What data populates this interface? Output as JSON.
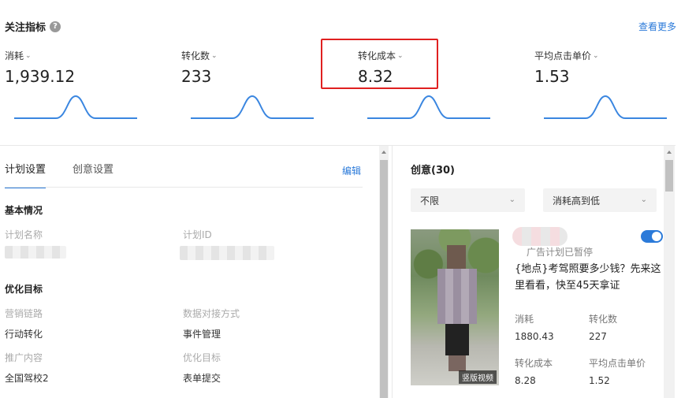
{
  "header": {
    "title": "关注指标",
    "help_icon": "?",
    "view_more": "查看更多"
  },
  "metrics": [
    {
      "label": "消耗",
      "value": "1,939.12"
    },
    {
      "label": "转化数",
      "value": "233"
    },
    {
      "label": "转化成本",
      "value": "8.32"
    },
    {
      "label": "平均点击单价",
      "value": "1.53"
    }
  ],
  "colors": {
    "accent": "#2b7ad9",
    "highlight": "#e02020",
    "sparkline": "#3a86e0"
  },
  "left_panel": {
    "tabs": [
      "计划设置",
      "创意设置"
    ],
    "active_tab": 0,
    "edit": "编辑",
    "basic": {
      "title": "基本情况",
      "plan_name_label": "计划名称",
      "plan_id_label": "计划ID"
    },
    "optimization": {
      "title": "优化目标",
      "marketing_chain_label": "营销链路",
      "marketing_chain_value": "行动转化",
      "data_method_label": "数据对接方式",
      "data_method_value": "事件管理",
      "promo_content_label": "推广内容",
      "promo_content_value": "全国驾校2",
      "opt_target_label": "优化目标",
      "opt_target_value": "表单提交"
    }
  },
  "right_panel": {
    "title": "创意(30)",
    "filter1": "不限",
    "filter2": "消耗高到低",
    "creative": {
      "video_badge": "竖版视频",
      "status": "广告计划已暂停",
      "text": "{地点}考驾照要多少钱？先来这里看看，快至45天拿证",
      "stats": [
        {
          "label": "消耗",
          "value": "1880.43"
        },
        {
          "label": "转化数",
          "value": "227"
        },
        {
          "label": "转化成本",
          "value": "8.28"
        },
        {
          "label": "平均点击单价",
          "value": "1.52"
        }
      ]
    }
  }
}
